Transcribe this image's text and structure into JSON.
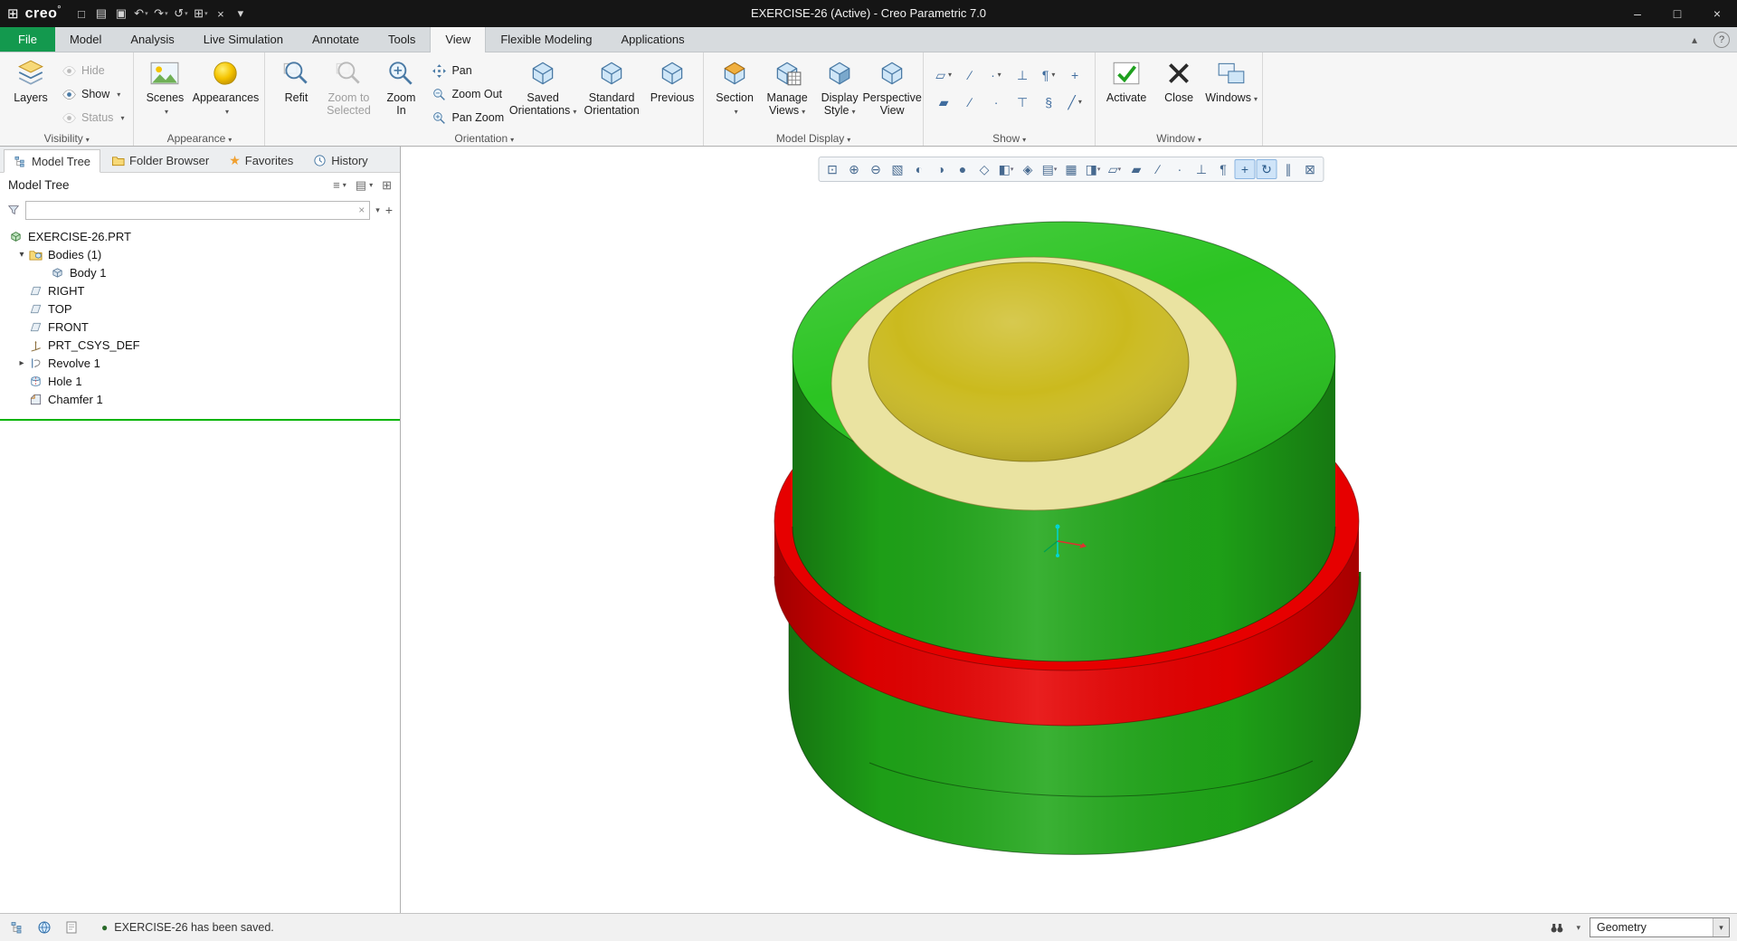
{
  "titlebar": {
    "logo": "creo",
    "logo_mark": "°",
    "title": "EXERCISE-26 (Active) - Creo Parametric 7.0"
  },
  "window_buttons": [
    {
      "name": "minimize-icon",
      "glyph": "–"
    },
    {
      "name": "maximize-icon",
      "glyph": "□"
    },
    {
      "name": "close-icon",
      "glyph": "×"
    }
  ],
  "quick_access": [
    {
      "name": "new-file-icon",
      "glyph": "□"
    },
    {
      "name": "open-file-icon",
      "glyph": "▤"
    },
    {
      "name": "save-icon",
      "glyph": "▣"
    },
    {
      "name": "undo-icon",
      "glyph": "↶",
      "dd": true
    },
    {
      "name": "redo-icon",
      "glyph": "↷",
      "dd": true
    },
    {
      "name": "regenerate-icon",
      "glyph": "↺",
      "dd": true
    },
    {
      "name": "windows-switch-icon",
      "glyph": "⊞",
      "dd": true
    },
    {
      "name": "close-window-icon",
      "glyph": "×"
    },
    {
      "name": "customize-toolbar-icon",
      "glyph": "▾"
    }
  ],
  "tabrow_icons": [
    {
      "name": "minimize-ribbon-icon",
      "glyph": "▴"
    },
    {
      "name": "help-icon",
      "glyph": "?"
    }
  ],
  "menu_tabs": [
    {
      "id": "file",
      "label": "File"
    },
    {
      "id": "model",
      "label": "Model"
    },
    {
      "id": "analysis",
      "label": "Analysis"
    },
    {
      "id": "live-simulation",
      "label": "Live Simulation"
    },
    {
      "id": "annotate",
      "label": "Annotate"
    },
    {
      "id": "tools",
      "label": "Tools"
    },
    {
      "id": "view",
      "label": "View",
      "active": true
    },
    {
      "id": "flexible-modeling",
      "label": "Flexible Modeling"
    },
    {
      "id": "applications",
      "label": "Applications"
    }
  ],
  "ribbon": {
    "visibility": {
      "label": "Visibility",
      "layers": "Layers",
      "hide": "Hide",
      "show": "Show",
      "status": "Status"
    },
    "appearance": {
      "label": "Appearance",
      "scenes": "Scenes",
      "appearances": "Appearances"
    },
    "orientation": {
      "label": "Orientation",
      "refit": "Refit",
      "zoom_to_selected": "Zoom to Selected",
      "zoom_in": "Zoom In",
      "pan": "Pan",
      "zoom_out": "Zoom Out",
      "pan_zoom": "Pan Zoom",
      "saved_orientations": "Saved Orientations",
      "standard_orientation": "Standard Orientation",
      "previous": "Previous"
    },
    "model_display": {
      "label": "Model Display",
      "section": "Section",
      "manage_views": "Manage Views",
      "display_style": "Display Style",
      "perspective_view": "Perspective View"
    },
    "show": {
      "label": "Show",
      "icons": [
        {
          "name": "plane-display-icon",
          "glyph": "▱",
          "dd": true
        },
        {
          "name": "axis-display-icon",
          "glyph": "∕"
        },
        {
          "name": "point-display-icon",
          "glyph": "∙",
          "dd": true
        },
        {
          "name": "csys-display-icon",
          "glyph": "⊥"
        },
        {
          "name": "annotation-display-icon",
          "glyph": "¶",
          "dd": true
        },
        {
          "name": "spin-center-icon",
          "glyph": "+"
        },
        {
          "name": "plane-tag-display-icon",
          "glyph": "▰"
        },
        {
          "name": "axis-tag-display-icon",
          "glyph": "∕"
        },
        {
          "name": "point-tag-display-icon",
          "glyph": "·"
        },
        {
          "name": "csys-tag-display-icon",
          "glyph": "⊤"
        },
        {
          "name": "note-display-icon",
          "glyph": "§"
        },
        {
          "name": "toggle-slash-icon",
          "glyph": "╱",
          "dd": true
        }
      ]
    },
    "window": {
      "label": "Window",
      "activate": "Activate",
      "close": "Close",
      "windows": "Windows"
    }
  },
  "navigator": {
    "tabs": [
      {
        "label": "Model Tree",
        "active": true
      },
      {
        "label": "Folder Browser"
      },
      {
        "label": "Favorites"
      },
      {
        "label": "History"
      }
    ],
    "header": "Model Tree",
    "header_icons": [
      {
        "name": "tree-settings-icon",
        "glyph": "≡",
        "dd": true
      },
      {
        "name": "tree-display-icon",
        "glyph": "▤",
        "dd": true
      },
      {
        "name": "tree-expand-all-icon",
        "glyph": "⊞"
      }
    ],
    "search_value": "",
    "clear_glyph": "×",
    "dropdown_glyph": "▾",
    "add_glyph": "+",
    "tree": [
      {
        "label": "EXERCISE-26.PRT",
        "icon": "part",
        "indent": 0
      },
      {
        "label": "Bodies (1)",
        "icon": "bodies",
        "indent": 1,
        "expand": "open"
      },
      {
        "label": "Body 1",
        "icon": "body",
        "indent": 2
      },
      {
        "label": "RIGHT",
        "icon": "plane",
        "indent": 1
      },
      {
        "label": "TOP",
        "icon": "plane",
        "indent": 1
      },
      {
        "label": "FRONT",
        "icon": "plane",
        "indent": 1
      },
      {
        "label": "PRT_CSYS_DEF",
        "icon": "csys",
        "indent": 1
      },
      {
        "label": "Revolve 1",
        "icon": "revolve",
        "indent": 1,
        "expand": "closed"
      },
      {
        "label": "Hole 1",
        "icon": "hole",
        "indent": 1
      },
      {
        "label": "Chamfer 1",
        "icon": "chamfer",
        "indent": 1
      }
    ]
  },
  "graphics": {
    "toolbar_icons": [
      {
        "name": "refit-icon",
        "glyph": "⊡"
      },
      {
        "name": "zoom-in-icon",
        "glyph": "⊕"
      },
      {
        "name": "zoom-out-icon",
        "glyph": "⊖"
      },
      {
        "name": "repaint-icon",
        "glyph": "▧"
      },
      {
        "name": "shade-with-edges-icon",
        "glyph": "◐"
      },
      {
        "name": "shade-with-reflections-icon",
        "glyph": "◑"
      },
      {
        "name": "shaded-icon",
        "glyph": "●"
      },
      {
        "name": "no-hidden-icon",
        "glyph": "◇"
      },
      {
        "name": "display-style-icon",
        "glyph": "◧",
        "dd": true
      },
      {
        "name": "perspective-icon",
        "glyph": "◈"
      },
      {
        "name": "saved-orientations-icon",
        "glyph": "▤",
        "dd": true
      },
      {
        "name": "view-manager-icon",
        "glyph": "▦"
      },
      {
        "name": "section-icon",
        "glyph": "◨",
        "dd": true
      },
      {
        "name": "datum-display-filters-icon",
        "glyph": "▱",
        "dd": true
      },
      {
        "name": "plane-display-icon",
        "glyph": "▰"
      },
      {
        "name": "axis-display-icon",
        "glyph": "∕"
      },
      {
        "name": "point-display-icon",
        "glyph": "∙"
      },
      {
        "name": "csys-display-icon",
        "glyph": "⊥"
      },
      {
        "name": "annotation-display-icon",
        "glyph": "¶"
      },
      {
        "name": "spin-center-icon",
        "glyph": "+",
        "active": true
      },
      {
        "name": "orient-mode-icon",
        "glyph": "↻",
        "active": true
      },
      {
        "name": "pause-icon",
        "glyph": "∥"
      },
      {
        "name": "clip-icon",
        "glyph": "⊠"
      }
    ],
    "model_colors": {
      "green_top": "#2bc422",
      "green_body": "#1fa618",
      "green_dark": "#157c10",
      "red": "#e60000",
      "red_dark": "#b30000",
      "cream": "#eae3a1",
      "yellow": "#cbba1e",
      "yellow_dark": "#a3930f"
    }
  },
  "statusbar": {
    "indicator": "●",
    "message": "EXERCISE-26 has been saved.",
    "selector": "Geometry"
  }
}
